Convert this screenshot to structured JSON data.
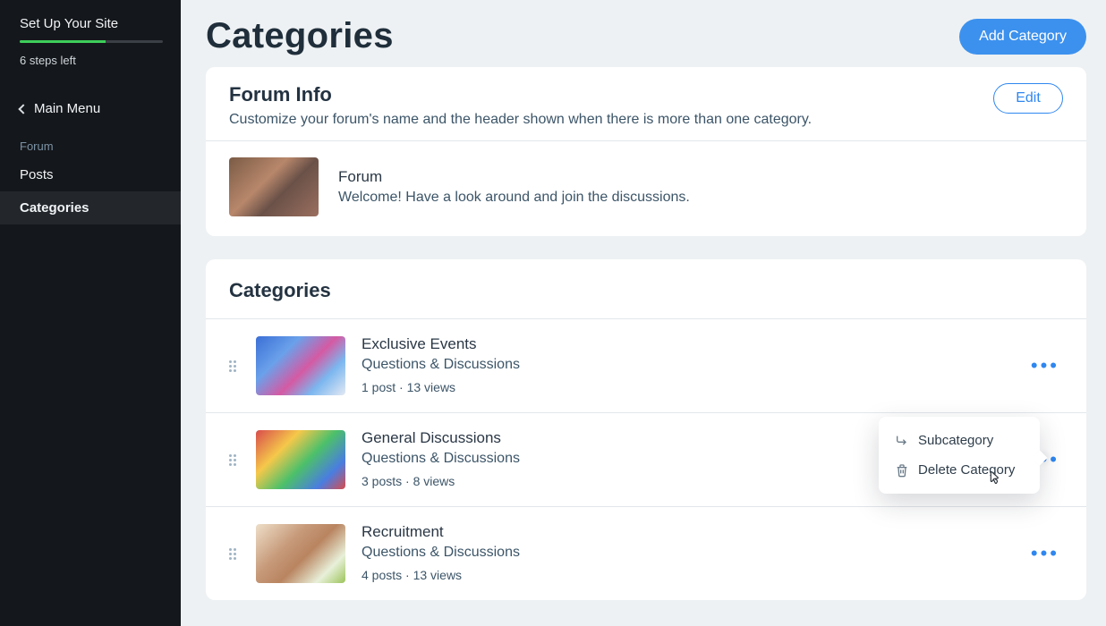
{
  "sidebar": {
    "setup_title": "Set Up Your Site",
    "steps_left": "6 steps left",
    "progress_pct": 60,
    "back_label": "Main Menu",
    "section_label": "Forum",
    "items": [
      {
        "label": "Posts",
        "active": false
      },
      {
        "label": "Categories",
        "active": true
      }
    ]
  },
  "page": {
    "title": "Categories",
    "add_button": "Add Category"
  },
  "forum_info": {
    "heading": "Forum Info",
    "sub": "Customize your forum's name and the header shown when there is more than one category.",
    "edit_button": "Edit",
    "forum_name": "Forum",
    "forum_desc": "Welcome! Have a look around and join the discussions."
  },
  "categories": {
    "heading": "Categories",
    "items": [
      {
        "title": "Exclusive Events",
        "subtitle": "Questions & Discussions",
        "meta": "1 post · 13 views",
        "thumb": "confetti"
      },
      {
        "title": "General Discussions",
        "subtitle": "Questions & Discussions",
        "meta": "3 posts · 8 views",
        "thumb": "mats"
      },
      {
        "title": "Recruitment",
        "subtitle": "Questions & Discussions",
        "meta": "4 posts · 13 views",
        "thumb": "woman"
      }
    ]
  },
  "popover": {
    "subcategory": "Subcategory",
    "delete": "Delete Category"
  }
}
